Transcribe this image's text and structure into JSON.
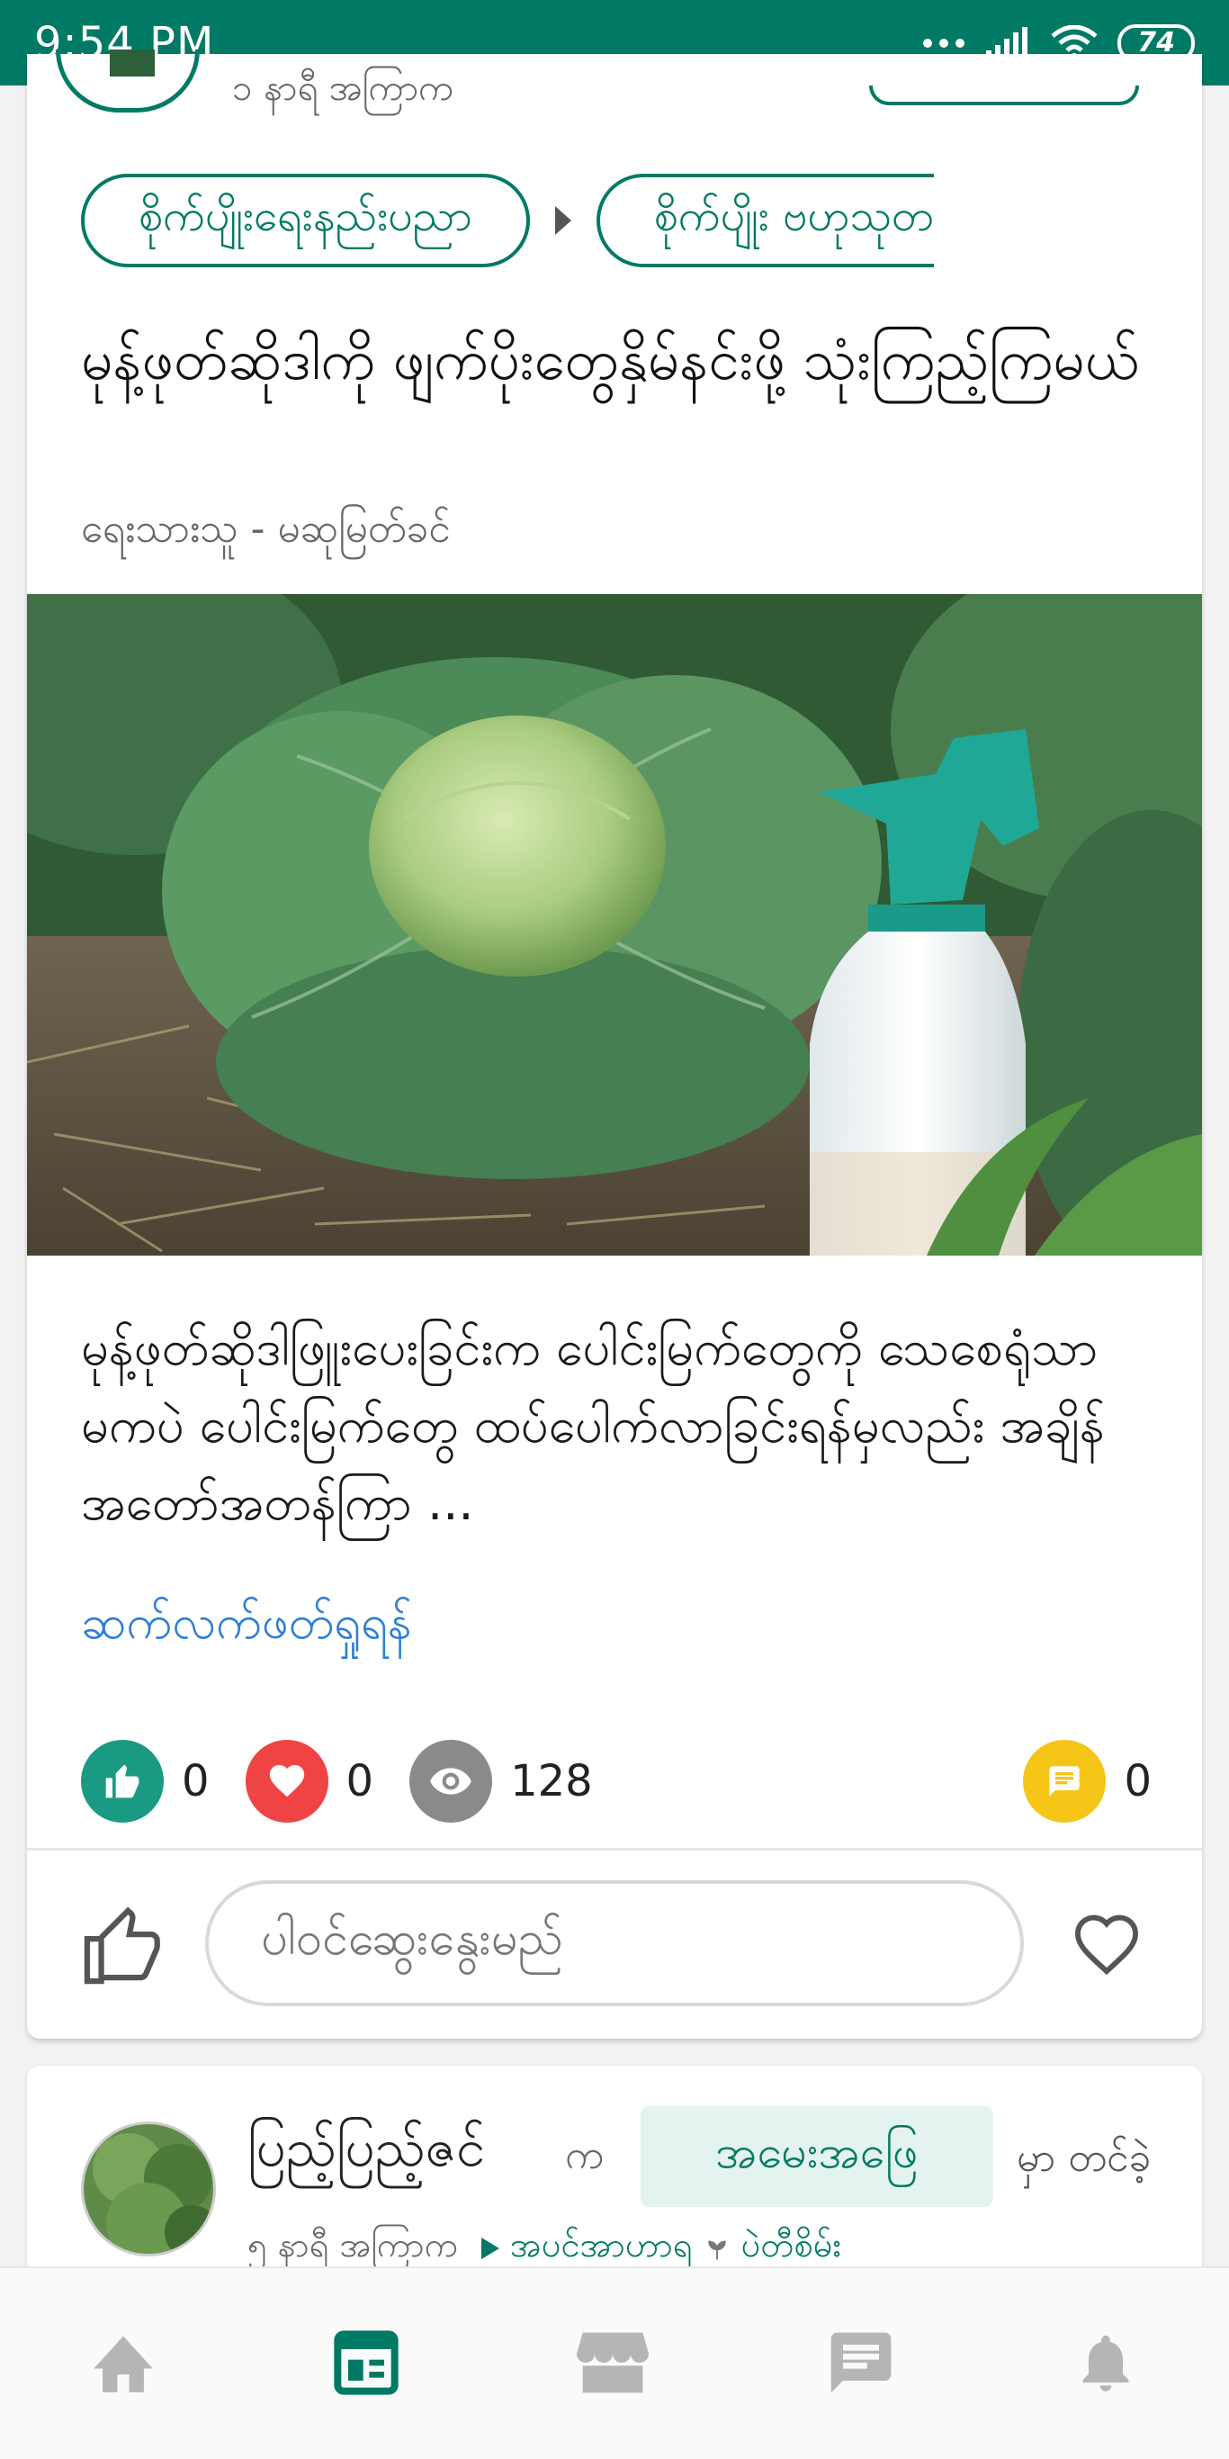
{
  "status_bar": {
    "time": "9:54 PM",
    "battery": "74"
  },
  "post1": {
    "posted_ago": "၁ နာရီ အကြာက",
    "breadcrumbs": [
      "စိုက်ပျိုးရေးနည်းပညာ",
      "စိုက်ပျိုး ဗဟုသုတ"
    ],
    "title": "မုန့်ဖုတ်ဆိုဒါကို ဖျက်ပိုးတွေနှိမ်နင်းဖို့ သုံးကြည့်ကြမယ်",
    "author": "ရေးသားသူ - မဆုမြတ်ခင်",
    "excerpt": "မုန့်ဖုတ်ဆိုဒါဖြူးပေးခြင်းက ပေါင်းမြက်တွေကို သေစေရုံသာမကပဲ ပေါင်းမြက်တွေ ထပ်ပေါက်လာခြင်းရန်မှလည်း အချိန်အတော်အတန်ကြာ ...",
    "read_more": "ဆက်လက်ဖတ်ရှုရန်",
    "stats": {
      "likes": "0",
      "loves": "0",
      "views": "128",
      "comments": "0"
    },
    "comment_placeholder": "ပါဝင်ဆွေးနွေးမည်"
  },
  "post2": {
    "author_name": "ပြည့်ပြည့်ဇင်",
    "ka": "က",
    "group": "အမေးအဖြေ",
    "posted_in": "မှာ တင်ခဲ့",
    "posted_ago": "၅ နာရီ အကြာက",
    "category": "အပင်အာဟာရ",
    "subcategory": "ပဲတီစိမ်း"
  },
  "colors": {
    "primary": "#007a64",
    "like": "#1a9a83",
    "love": "#f04343",
    "views": "#8a8a8a",
    "comments": "#f5c518",
    "link": "#2d7fd4"
  },
  "bottom_nav": [
    "home-icon",
    "newsfeed-icon",
    "marketplace-icon",
    "messages-icon",
    "notifications-icon"
  ]
}
